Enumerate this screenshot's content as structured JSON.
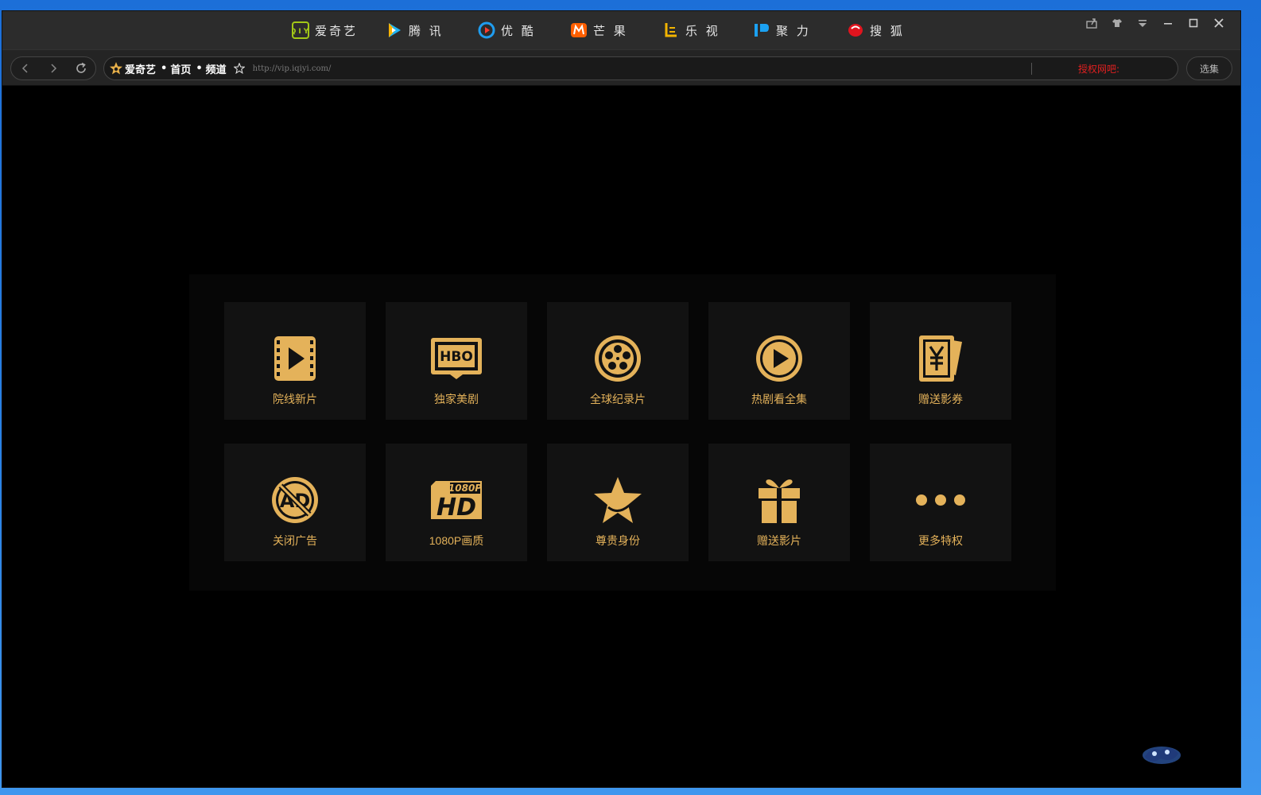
{
  "sites": [
    {
      "label": "爱奇艺",
      "icon": "iqiyi-logo-icon"
    },
    {
      "label": "腾 讯",
      "icon": "tencent-video-logo-icon"
    },
    {
      "label": "优 酷",
      "icon": "youku-logo-icon"
    },
    {
      "label": "芒 果",
      "icon": "mango-tv-logo-icon"
    },
    {
      "label": "乐 视",
      "icon": "letv-logo-icon"
    },
    {
      "label": "聚 力",
      "icon": "pptv-logo-icon"
    },
    {
      "label": "搜 狐",
      "icon": "sohu-logo-icon"
    }
  ],
  "window_controls": [
    "share-icon",
    "skin-icon",
    "menu-icon",
    "minimize-icon",
    "maximize-icon",
    "close-icon"
  ],
  "address": {
    "crumbs": [
      "爱奇艺",
      "首页",
      "频道"
    ],
    "url": "http://vip.iqiyi.com/",
    "auth_text": "授权网吧:"
  },
  "select_button": "选集",
  "features": [
    {
      "label": "院线新片",
      "icon": "film-play-icon"
    },
    {
      "label": "独家美剧",
      "icon": "hbo-tv-icon"
    },
    {
      "label": "全球纪录片",
      "icon": "film-reel-icon"
    },
    {
      "label": "热剧看全集",
      "icon": "play-circle-icon"
    },
    {
      "label": "赠送影券",
      "icon": "yuan-ticket-icon"
    },
    {
      "label": "关闭广告",
      "icon": "no-ad-icon"
    },
    {
      "label": "1080P画质",
      "icon": "hd-1080p-icon"
    },
    {
      "label": "尊贵身份",
      "icon": "star-icon"
    },
    {
      "label": "赠送影片",
      "icon": "gift-icon"
    },
    {
      "label": "更多特权",
      "icon": "more-dots-icon"
    }
  ],
  "colors": {
    "accent": "#e4b25a",
    "tile_bg": "#121212",
    "auth_red": "#e02020"
  }
}
